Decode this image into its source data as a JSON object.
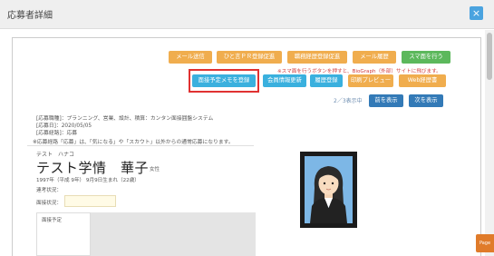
{
  "modal": {
    "title": "応募者詳細",
    "close_label": "×"
  },
  "toolbar": {
    "row1": [
      "メール送信",
      "ひと言ＰＲ登録促進",
      "職務経歴登録促進",
      "メール履歴",
      "スマ面を行う"
    ],
    "note": "※スマ面を行うボタンを押すと、BioGraph（外部）サイトに飛びます。",
    "row2": [
      "面接予定メモを登録",
      "会員情報更新",
      "履歴登録",
      "印刷プレビュー",
      "Web経歴書"
    ]
  },
  "pager": {
    "count": "2／3表示中",
    "prev": "前を表示",
    "next": "次を表示"
  },
  "info": {
    "line1": "[応募職種]：プランニング、営業、設計、積算：カンタン面接囲盤システム",
    "line2": "[応募日]：2020/05/05",
    "line3": "[応募経路]：応募",
    "line4": "※応募経路「応募」は、「気になる」や「スカウト」以外からの通常応募になります。"
  },
  "profile": {
    "kana": "テスト　ハナコ",
    "name": "テスト学情　華子",
    "gender": "女性",
    "birth": "1997年（平成 9年） 9月9日生まれ（22歳）",
    "contact_status_label": "連考状況：",
    "interview_status_label": "面接状況：",
    "interview_plan_label": "面接予定"
  },
  "side_tab": {
    "label": "Page"
  },
  "colors": {
    "orange": "#f0ad4e",
    "green": "#5cb85c",
    "teal": "#3ab0de",
    "navy": "#337ab7",
    "highlight": "#e03131"
  }
}
